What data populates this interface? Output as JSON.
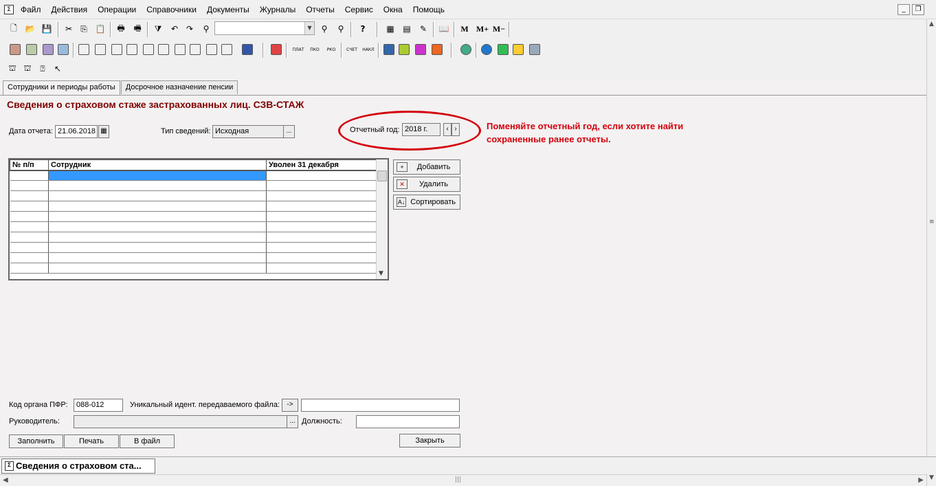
{
  "menu": {
    "items": [
      "Файл",
      "Действия",
      "Операции",
      "Справочники",
      "Документы",
      "Журналы",
      "Отчеты",
      "Сервис",
      "Окна",
      "Помощь"
    ]
  },
  "toolbar": {
    "memory_buttons": [
      "M",
      "M+",
      "M−"
    ],
    "report_icons": [
      "ПЛАТ",
      "ПКО",
      "РКО",
      "СЧЕТ",
      "НАКЛ"
    ]
  },
  "tabs": [
    "Сотрудники и периоды работы",
    "Досрочное назначение пенсии"
  ],
  "form": {
    "title": "Сведения о страховом стаже застрахованных лиц. СЗВ-СТАЖ",
    "report_date_label": "Дата отчета:",
    "report_date_value": "21.06.2018",
    "info_type_label": "Тип сведений:",
    "info_type_value": "Исходная",
    "report_year_label": "Отчетный год:",
    "report_year_value": "2018 г."
  },
  "annotation": {
    "text": "Поменяйте отчетный год, если хотите найти\nсохраненные ранее отчеты."
  },
  "grid": {
    "columns": [
      "№ п/п",
      "Сотрудник",
      "Уволен 31 декабря"
    ]
  },
  "side_buttons": {
    "add": "Добавить",
    "delete": "Удалить",
    "sort": "Сортировать"
  },
  "footer": {
    "pfr_code_label": "Код органа ПФР:",
    "pfr_code_value": "088-012",
    "file_id_label": "Уникальный идент. передаваемого файла:",
    "arrow_btn": "->",
    "manager_label": "Руководитель:",
    "position_label": "Должность:",
    "fill_btn": "Заполнить",
    "print_btn": "Печать",
    "file_btn": "В файл",
    "close_btn": "Закрыть"
  },
  "taskbar": {
    "item": "Сведения о страховом ста..."
  },
  "colors": {
    "title": "#800000",
    "annotation": "#d3000c",
    "selection": "#3399ff"
  }
}
